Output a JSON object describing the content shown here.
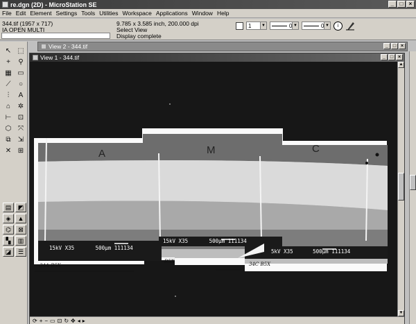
{
  "window": {
    "title": "re.dgn (2D) - MicroStation SE",
    "controls": {
      "minimize": "_",
      "maximize": "□",
      "close": "×"
    }
  },
  "menu": [
    "File",
    "Edit",
    "Element",
    "Settings",
    "Tools",
    "Utilities",
    "Workspace",
    "Applications",
    "Window",
    "Help"
  ],
  "status": {
    "file_info": "344.tif (1957 x 717)",
    "mode": "IA OPEN MULTI",
    "dimensions": "9.785 x 3.585 inch, 200.000 dpi",
    "prompt": "Select View",
    "message": "Display complete"
  },
  "attributes": {
    "color_value": "1",
    "style_value": "0",
    "weight_value": "0",
    "info_icon": "i"
  },
  "views": {
    "view2_title": "View 2 - 344.tif",
    "view1_title": "View 1 - 344.tif"
  },
  "image": {
    "region_labels": [
      "A",
      "M",
      "C"
    ],
    "scale_bars": [
      {
        "kv": "15kV",
        "mag": "X35",
        "len": "500μm",
        "id": "111134"
      },
      {
        "kv": "15kV",
        "mag": "X35",
        "len": "500μm",
        "id": "111134"
      },
      {
        "kv": "5kV",
        "mag": "X35",
        "len": "500μm",
        "id": "111134"
      }
    ],
    "handwritten": [
      "34A B5X",
      "B5X",
      "34C B5X"
    ]
  },
  "colors": {
    "canvas_bg": "#171717",
    "chrome": "#d4d0c8",
    "titlebar": "#3a3a3a"
  }
}
